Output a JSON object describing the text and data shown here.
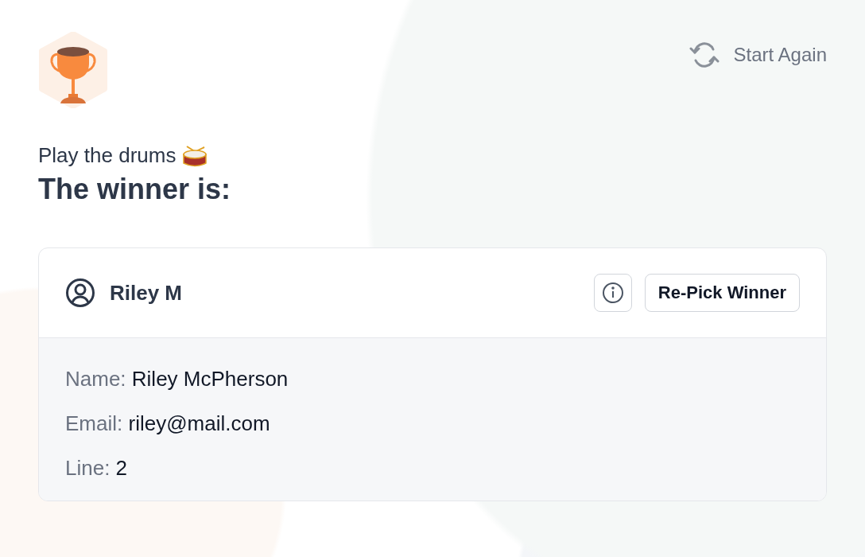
{
  "header": {
    "action": "Start Again"
  },
  "prompt": "Play the drums",
  "title": "The winner is:",
  "winner": {
    "display_name": "Riley M",
    "button": "Re-Pick Winner",
    "details": [
      {
        "label": "Name:",
        "value": "Riley McPherson"
      },
      {
        "label": "Email:",
        "value": "riley@mail.com"
      },
      {
        "label": "Line:",
        "value": "2"
      }
    ]
  }
}
